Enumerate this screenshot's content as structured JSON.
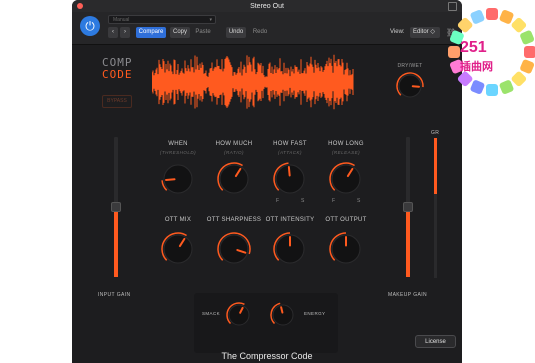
{
  "window": {
    "title": "Stereo Out"
  },
  "toolbar": {
    "preset": "Manual",
    "compare": "Compare",
    "copy": "Copy",
    "paste": "Paste",
    "undo": "Undo",
    "redo": "Redo",
    "view_label": "View:",
    "view_value": "Editor"
  },
  "plugin": {
    "logo_line1": "COMP",
    "logo_line2": "CODE",
    "bypass": "BYPASS",
    "drywet": "DRY/WET",
    "knobs_row1": [
      {
        "label": "WHEN",
        "sub": "(THRESHOLD)",
        "value": 0.15
      },
      {
        "label": "HOW MUCH",
        "sub": "(RATIO)",
        "value": 0.62
      },
      {
        "label": "HOW FAST",
        "sub": "(ATTACK)",
        "value": 0.48,
        "min_label": "F",
        "max_label": "S"
      },
      {
        "label": "HOW LONG",
        "sub": "(RELEASE)",
        "value": 0.62,
        "min_label": "F",
        "max_label": "S"
      }
    ],
    "knobs_row2": [
      {
        "label": "OTT MIX",
        "value": 0.62
      },
      {
        "label": "OTT SHARPNESS",
        "value": 0.9
      },
      {
        "label": "OTT INTENSITY",
        "value": 0.5
      },
      {
        "label": "OTT OUTPUT",
        "value": 0.5
      }
    ],
    "drywet_value": 0.85,
    "input_gain_label": "INPUT GAIN",
    "input_gain_value": 0.5,
    "makeup_gain_label": "MAKEUP GAIN",
    "makeup_gain_value": 0.5,
    "gr_label": "GR",
    "gr_value": 0.4,
    "smack_label": "SMACK",
    "smack_value": 0.6,
    "energy_label": "ENERGY",
    "energy_value": 0.45,
    "footer_title": "The Compressor Code",
    "license": "License"
  },
  "colors": {
    "accent": "#ff5a1f",
    "background": "#1d1d1f",
    "blue": "#2f6fd9"
  },
  "watermark": {
    "text_num": "251",
    "text_cn": "插曲网"
  }
}
